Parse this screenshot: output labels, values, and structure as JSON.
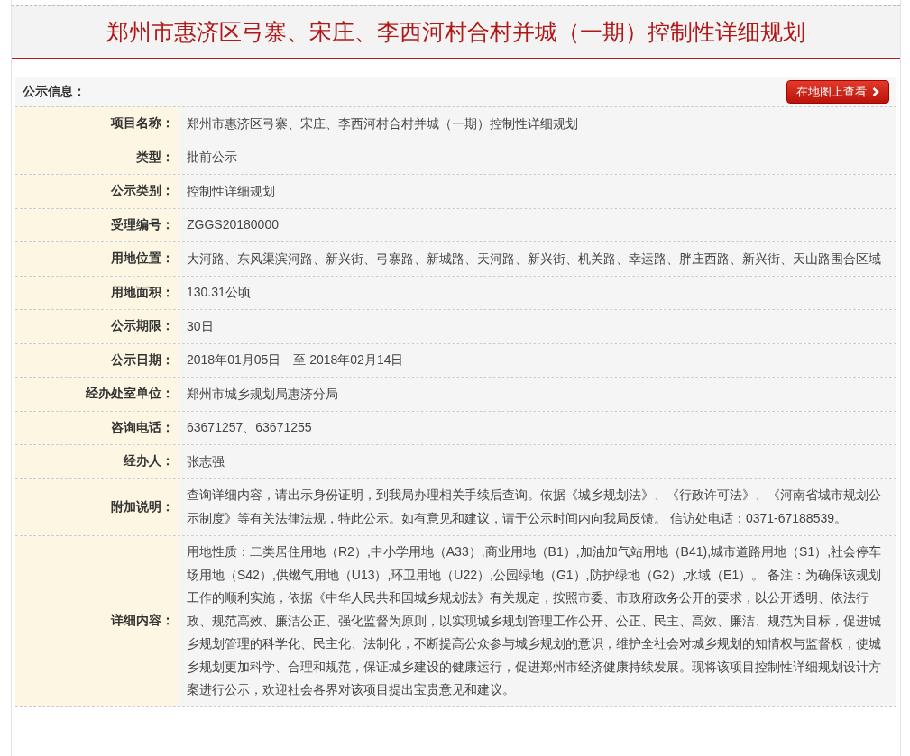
{
  "title": "郑州市惠济区弓寨、宋庄、李西河村合村并城（一期）控制性详细规划",
  "section": {
    "label": "公示信息：",
    "map_button": "在地图上查看"
  },
  "rows": [
    {
      "label": "项目名称：",
      "value": "郑州市惠济区弓寨、宋庄、李西河村合村并城（一期）控制性详细规划"
    },
    {
      "label": "类型：",
      "value": "批前公示"
    },
    {
      "label": "公示类别：",
      "value": "控制性详细规划"
    },
    {
      "label": "受理编号：",
      "value": "ZGGS20180000"
    },
    {
      "label": "用地位置：",
      "value": "大河路、东风渠滨河路、新兴街、弓寨路、新城路、天河路、新兴街、机关路、幸运路、胖庄西路、新兴街、天山路围合区域"
    },
    {
      "label": "用地面积：",
      "value": "130.31公顷"
    },
    {
      "label": "公示期限：",
      "value": "30日"
    },
    {
      "label": "公示日期：",
      "value": "2018年01月05日　至 2018年02月14日"
    },
    {
      "label": "经办处室单位：",
      "value": "郑州市城乡规划局惠济分局"
    },
    {
      "label": "咨询电话：",
      "value": "63671257、63671255"
    },
    {
      "label": "经办人：",
      "value": "张志强"
    },
    {
      "label": "附加说明：",
      "value": "查询详细内容，请出示身份证明，到我局办理相关手续后查询。依据《城乡规划法》、《行政许可法》、《河南省城市规划公示制度》等有关法律法规，特此公示。如有意见和建议，请于公示时间内向我局反馈。 信访处电话：0371-67188539。"
    },
    {
      "label": "详细内容：",
      "value": "用地性质：二类居住用地（R2）,中小学用地（A33）,商业用地（B1）,加油加气站用地（B41),城市道路用地（S1）,社会停车场用地（S42）,供燃气用地（U13）,环卫用地（U22）,公园绿地（G1）,防护绿地（G2）,水域（E1）。 备注：为确保该规划工作的顺利实施，依据《中华人民共和国城乡规划法》有关规定，按照市委、市政府政务公开的要求，以公开透明、依法行政、规范高效、廉洁公正、强化监督为原则，以实现城乡规划管理工作公开、公正、民主、高效、廉洁、规范为目标，促进城乡规划管理的科学化、民主化、法制化，不断提高公众参与城乡规划的意识，维护全社会对城乡规划的知情权与监督权，使城乡规划更加科学、合理和规范，保证城乡建设的健康运行，促进郑州市经济健康持续发展。现将该项目控制性详细规划设计方案进行公示，欢迎社会各界对该项目提出宝贵意见和建议。"
    }
  ]
}
